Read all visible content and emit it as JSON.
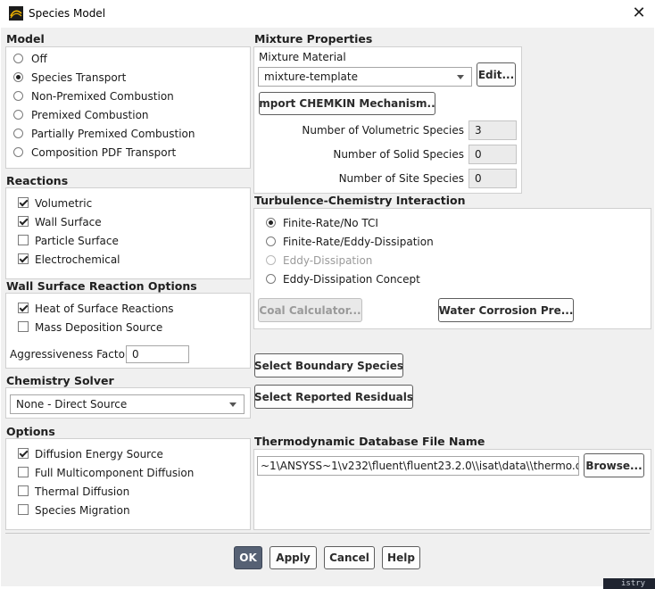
{
  "window": {
    "title": "Species Model",
    "close_icon": "close-icon",
    "app_icon": "fluent-logo-icon"
  },
  "model": {
    "label": "Model",
    "options": [
      {
        "label": "Off",
        "selected": false
      },
      {
        "label": "Species Transport",
        "selected": true
      },
      {
        "label": "Non-Premixed Combustion",
        "selected": false
      },
      {
        "label": "Premixed Combustion",
        "selected": false
      },
      {
        "label": "Partially Premixed Combustion",
        "selected": false
      },
      {
        "label": "Composition PDF Transport",
        "selected": false
      }
    ]
  },
  "reactions": {
    "label": "Reactions",
    "options": [
      {
        "label": "Volumetric",
        "checked": true
      },
      {
        "label": "Wall Surface",
        "checked": true
      },
      {
        "label": "Particle Surface",
        "checked": false
      },
      {
        "label": "Electrochemical",
        "checked": true
      }
    ]
  },
  "wall_surface": {
    "label": "Wall Surface Reaction Options",
    "options": [
      {
        "label": "Heat of Surface Reactions",
        "checked": true
      },
      {
        "label": "Mass Deposition Source",
        "checked": false
      }
    ],
    "aggressiveness_label": "Aggressiveness Factor",
    "aggressiveness_value": "0"
  },
  "chemistry_solver": {
    "label": "Chemistry Solver",
    "value": "None - Direct Source"
  },
  "options": {
    "label": "Options",
    "items": [
      {
        "label": "Diffusion Energy Source",
        "checked": true
      },
      {
        "label": "Full Multicomponent Diffusion",
        "checked": false
      },
      {
        "label": "Thermal Diffusion",
        "checked": false
      },
      {
        "label": "Species Migration",
        "checked": false
      }
    ]
  },
  "mixture": {
    "label": "Mixture Properties",
    "material_label": "Mixture Material",
    "material_value": "mixture-template",
    "edit_button": "Edit...",
    "import_button": "Import CHEMKIN Mechanism...",
    "volumetric_label": "Number of Volumetric Species",
    "volumetric_value": "3",
    "solid_label": "Number of Solid Species",
    "solid_value": "0",
    "site_label": "Number of Site Species",
    "site_value": "0"
  },
  "tci": {
    "label": "Turbulence-Chemistry Interaction",
    "options": [
      {
        "label": "Finite-Rate/No TCI",
        "selected": true,
        "disabled": false
      },
      {
        "label": "Finite-Rate/Eddy-Dissipation",
        "selected": false,
        "disabled": false
      },
      {
        "label": "Eddy-Dissipation",
        "selected": false,
        "disabled": true
      },
      {
        "label": "Eddy-Dissipation Concept",
        "selected": false,
        "disabled": false
      }
    ],
    "coal_button": "Coal Calculator...",
    "water_button": "Water Corrosion Pre..."
  },
  "boundary_button": "Select Boundary Species",
  "residuals_button": "Select Reported Residuals",
  "thermo": {
    "label": "Thermodynamic Database File Name",
    "value": "~1\\ANSYSS~1\\v232\\fluent\\fluent23.2.0\\\\isat\\data\\\\thermo.db",
    "browse_button": "Browse..."
  },
  "footer": {
    "ok": "OK",
    "apply": "Apply",
    "cancel": "Cancel",
    "help": "Help"
  },
  "background_text": "istry"
}
